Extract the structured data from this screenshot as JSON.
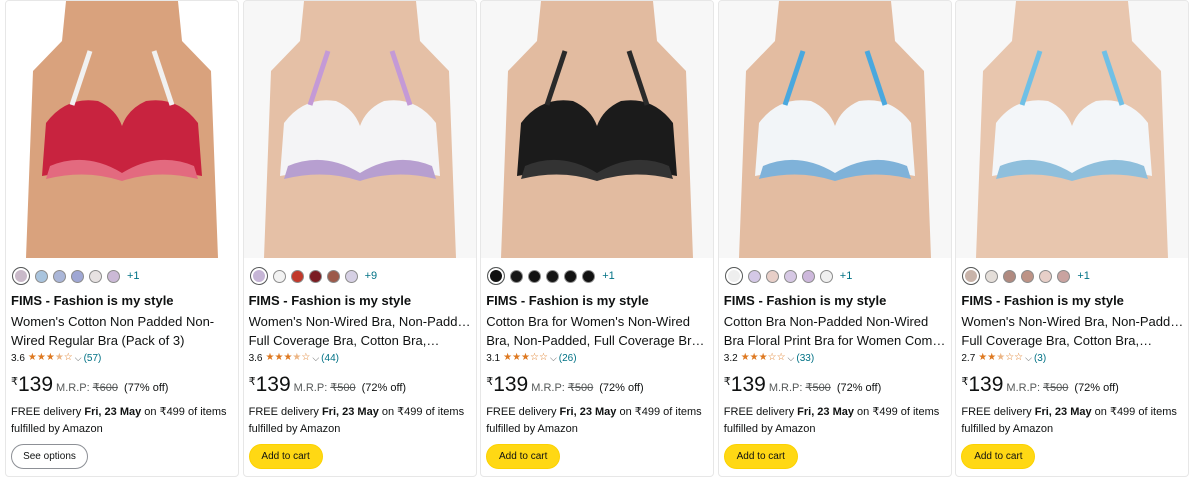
{
  "products": [
    {
      "brand": "FIMS - Fashion is my style",
      "title_line1": "Women's Cotton Non Padded Non-",
      "title_line2": "Wired Regular Bra (Pack of 3)",
      "rating": "3.6",
      "rating_stars": 3.5,
      "reviews": "(57)",
      "currency": "₹",
      "price": "139",
      "mrp_label": "M.R.P:",
      "mrp": "₹600",
      "discount": "(77% off)",
      "delivery_prefix": "FREE delivery ",
      "delivery_date": "Fri, 23 May",
      "delivery_suffix": " on ₹499 of items",
      "delivery_line2": "fulfilled by Amazon",
      "more_colors": "+1",
      "swatches": [
        "#c9b9c9",
        "#a9c4de",
        "#aab6d8",
        "#9fa7d4",
        "#e7e2e2",
        "#cbb9d6"
      ],
      "button": "See options",
      "button_type": "options",
      "image": {
        "bg": "#ffffff",
        "garment": "#c8233f",
        "accent": "#f1f1f1",
        "pattern": "#e36a7f",
        "skin": "#d9a27d"
      }
    },
    {
      "brand": "FIMS - Fashion is my style",
      "title_line1": "Women's Non-Wired Bra, Non-Padded,",
      "title_line2": "Full Coverage Bra, Cotton Bra,…",
      "rating": "3.6",
      "rating_stars": 3.5,
      "reviews": "(44)",
      "currency": "₹",
      "price": "139",
      "mrp_label": "M.R.P:",
      "mrp": "₹500",
      "discount": "(72% off)",
      "delivery_prefix": "FREE delivery ",
      "delivery_date": "Fri, 23 May",
      "delivery_suffix": " on ₹499 of items",
      "delivery_line2": "fulfilled by Amazon",
      "more_colors": "+9",
      "swatches": [
        "#c6b5d6",
        "#f2f2f2",
        "#c1392b",
        "#7a1c22",
        "#9c5a4a",
        "#d6d0e4"
      ],
      "button": "Add to cart",
      "button_type": "cart",
      "image": {
        "bg": "#f7f7f7",
        "garment": "#f4f4f6",
        "accent": "#c49ad6",
        "pattern": "#b79fd0",
        "skin": "#e5c0a6"
      }
    },
    {
      "brand": "FIMS - Fashion is my style",
      "title_line1": "Cotton Bra for Women's Non-Wired",
      "title_line2": "Bra, Non-Padded, Full Coverage Bra,…",
      "rating": "3.1",
      "rating_stars": 3,
      "reviews": "(26)",
      "currency": "₹",
      "price": "139",
      "mrp_label": "M.R.P:",
      "mrp": "₹500",
      "discount": "(72% off)",
      "delivery_prefix": "FREE delivery ",
      "delivery_date": "Fri, 23 May",
      "delivery_suffix": " on ₹499 of items",
      "delivery_line2": "fulfilled by Amazon",
      "more_colors": "+1",
      "swatches": [
        "#111111",
        "#161616",
        "#111111",
        "#151515",
        "#121212",
        "#111111"
      ],
      "button": "Add to cart",
      "button_type": "cart",
      "image": {
        "bg": "#f7f7f7",
        "garment": "#1b1b1b",
        "accent": "#2a2a2a",
        "pattern": "#333333",
        "skin": "#e2bba0"
      }
    },
    {
      "brand": "FIMS - Fashion is my style",
      "title_line1": "Cotton Bra Non-Padded Non-Wired",
      "title_line2": "Bra Floral Print Bra for Women Com…",
      "rating": "3.2",
      "rating_stars": 3,
      "reviews": "(33)",
      "currency": "₹",
      "price": "139",
      "mrp_label": "M.R.P:",
      "mrp": "₹500",
      "discount": "(72% off)",
      "delivery_prefix": "FREE delivery ",
      "delivery_date": "Fri, 23 May",
      "delivery_suffix": " on ₹499 of items",
      "delivery_line2": "fulfilled by Amazon",
      "more_colors": "+1",
      "swatches": [
        "#eeeeee",
        "#d4c8e6",
        "#e8cfc8",
        "#d6c8e4",
        "#cdb8dc",
        "#f0f0f0"
      ],
      "button": "Add to cart",
      "button_type": "cart",
      "image": {
        "bg": "#f7f7f7",
        "garment": "#f2f5f8",
        "accent": "#4aa8de",
        "pattern": "#7fb2d9",
        "skin": "#e3bca1"
      }
    },
    {
      "brand": "FIMS - Fashion is my style",
      "title_line1": "Women's Non-Wired Bra, Non-Padded,",
      "title_line2": "Full Coverage Bra, Cotton Bra,…",
      "rating": "2.7",
      "rating_stars": 2.5,
      "reviews": "(3)",
      "currency": "₹",
      "price": "139",
      "mrp_label": "M.R.P:",
      "mrp": "₹500",
      "discount": "(72% off)",
      "delivery_prefix": "FREE delivery ",
      "delivery_date": "Fri, 23 May",
      "delivery_suffix": " on ₹499 of items",
      "delivery_line2": "fulfilled by Amazon",
      "more_colors": "+1",
      "swatches": [
        "#c8b3a9",
        "#e4ded9",
        "#b08a80",
        "#bd9386",
        "#e7cfc8",
        "#c9a3a0"
      ],
      "button": "Add to cart",
      "button_type": "cart",
      "image": {
        "bg": "#f7f7f7",
        "garment": "#f3f6f9",
        "accent": "#6fc0e6",
        "pattern": "#8fbfdc",
        "skin": "#e8c6ae"
      }
    }
  ]
}
